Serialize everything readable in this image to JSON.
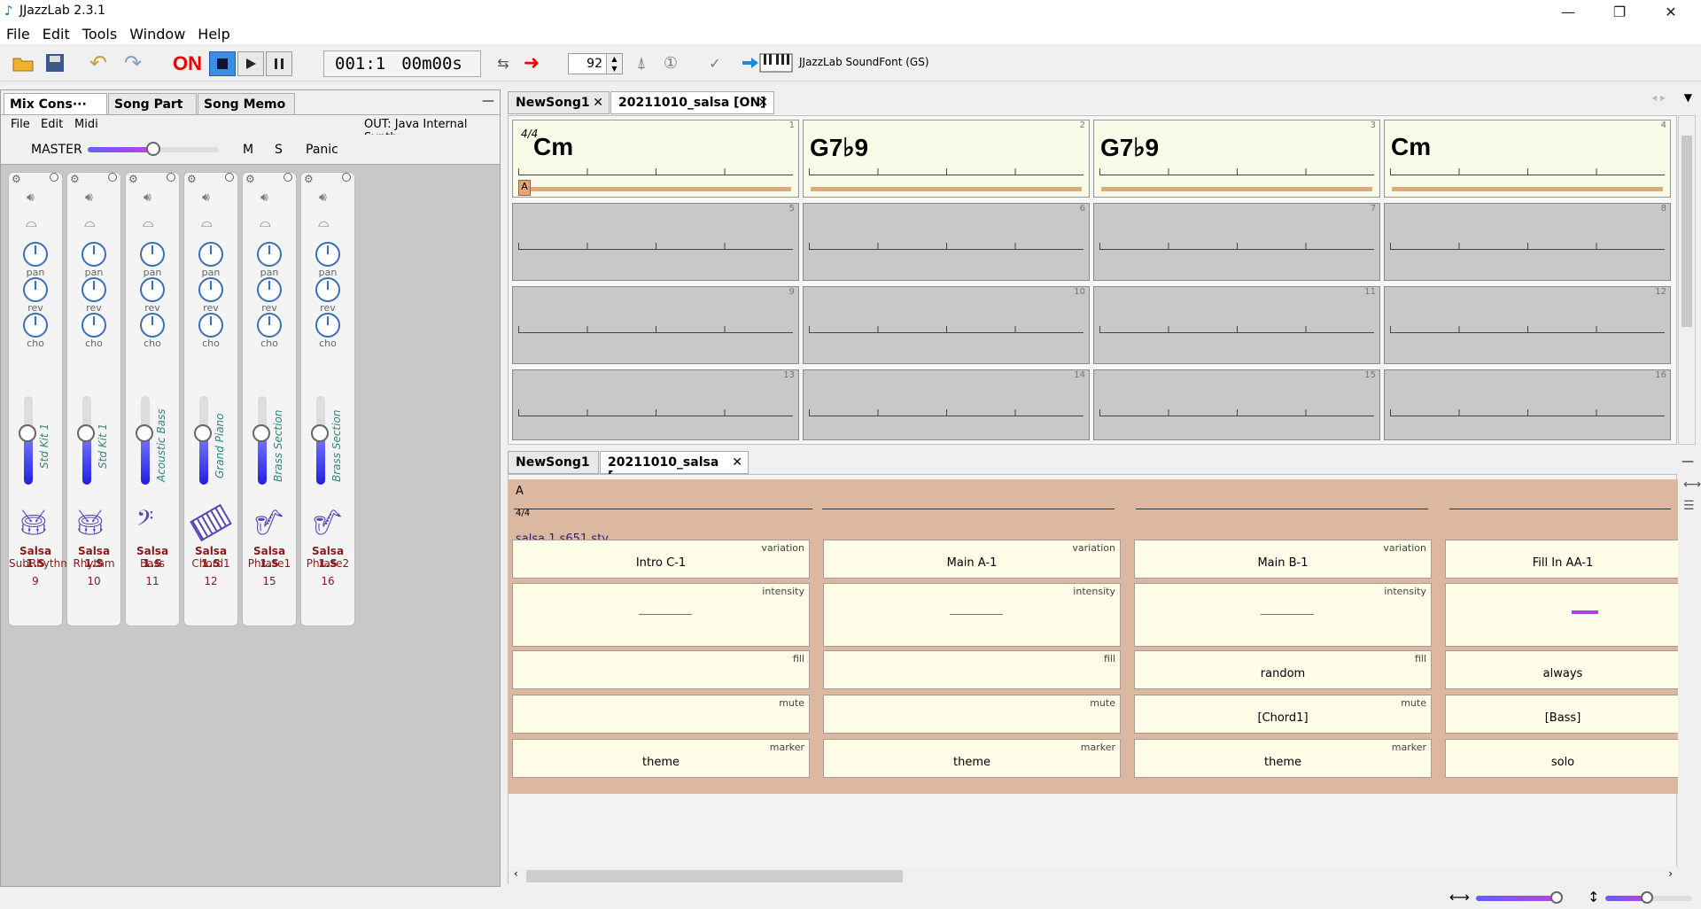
{
  "app": {
    "title": "JJazzLab  2.3.1"
  },
  "menu": [
    "File",
    "Edit",
    "Tools",
    "Window",
    "Help"
  ],
  "toolbar": {
    "on": "ON",
    "position": "001:1",
    "time": "00m00s",
    "tempo": "92",
    "soundfont": "JJazzLab SoundFont (GS)"
  },
  "left": {
    "tabs": [
      "Mix Cons···",
      "Song Part",
      "Song Memo"
    ],
    "menu": [
      "File",
      "Edit",
      "Midi"
    ],
    "out": "OUT: Java Internal Synth",
    "master": "MASTER",
    "m": "M",
    "s": "S",
    "panic": "Panic",
    "knobs": [
      "pan",
      "rev",
      "cho"
    ],
    "strips": [
      {
        "instrument": "Std Kit 1",
        "style": "Salsa 1.S",
        "part": "SubRhythm",
        "channel": "9"
      },
      {
        "instrument": "Std Kit 1",
        "style": "Salsa 1.S",
        "part": "Rhythm",
        "channel": "10"
      },
      {
        "instrument": "Acoustic Bass",
        "style": "Salsa 1.S",
        "part": "Bass",
        "channel": "11"
      },
      {
        "instrument": "Grand Piano",
        "style": "Salsa 1.S",
        "part": "Chord1",
        "channel": "12"
      },
      {
        "instrument": "Brass Section",
        "style": "Salsa 1.S",
        "part": "Phrase1",
        "channel": "15"
      },
      {
        "instrument": "Brass Section",
        "style": "Salsa 1.S",
        "part": "Phrase2",
        "channel": "16"
      }
    ]
  },
  "song": {
    "tabs": [
      "NewSong1",
      "20211010_salsa  [ON]"
    ],
    "timesig": "4/4",
    "section": "A",
    "bars": [
      {
        "n": "1",
        "chord": "Cm"
      },
      {
        "n": "2",
        "chord": "G7♭9"
      },
      {
        "n": "3",
        "chord": "G7♭9"
      },
      {
        "n": "4",
        "chord": "Cm"
      },
      {
        "n": "5"
      },
      {
        "n": "6"
      },
      {
        "n": "7"
      },
      {
        "n": "8"
      },
      {
        "n": "9"
      },
      {
        "n": "10"
      },
      {
        "n": "11"
      },
      {
        "n": "12"
      },
      {
        "n": "13"
      },
      {
        "n": "14"
      },
      {
        "n": "15"
      },
      {
        "n": "16"
      }
    ]
  },
  "rp": {
    "tabs": [
      "NewSong1",
      "20211010_salsa [···"
    ],
    "section": "A",
    "timesig": "4/4",
    "style": "salsa 1.s651.sty",
    "labels": {
      "variation": "variation",
      "intensity": "intensity",
      "fill": "fill",
      "mute": "mute",
      "marker": "marker"
    },
    "cols": [
      {
        "variation": "Intro C-1",
        "fill": "",
        "mute": "",
        "marker": "theme"
      },
      {
        "variation": "Main A-1",
        "fill": "",
        "mute": "",
        "marker": "theme"
      },
      {
        "variation": "Main B-1",
        "fill": "random",
        "mute": "[Chord1]",
        "marker": "theme"
      },
      {
        "variation": "Fill In AA-1",
        "fill": "always",
        "mute": "[Bass]",
        "marker": "solo"
      }
    ]
  },
  "colors": {
    "accent": "#3b8fe0",
    "on": "#e00000",
    "chordbg": "#fafae8",
    "rphead": "#dcb8a0"
  }
}
